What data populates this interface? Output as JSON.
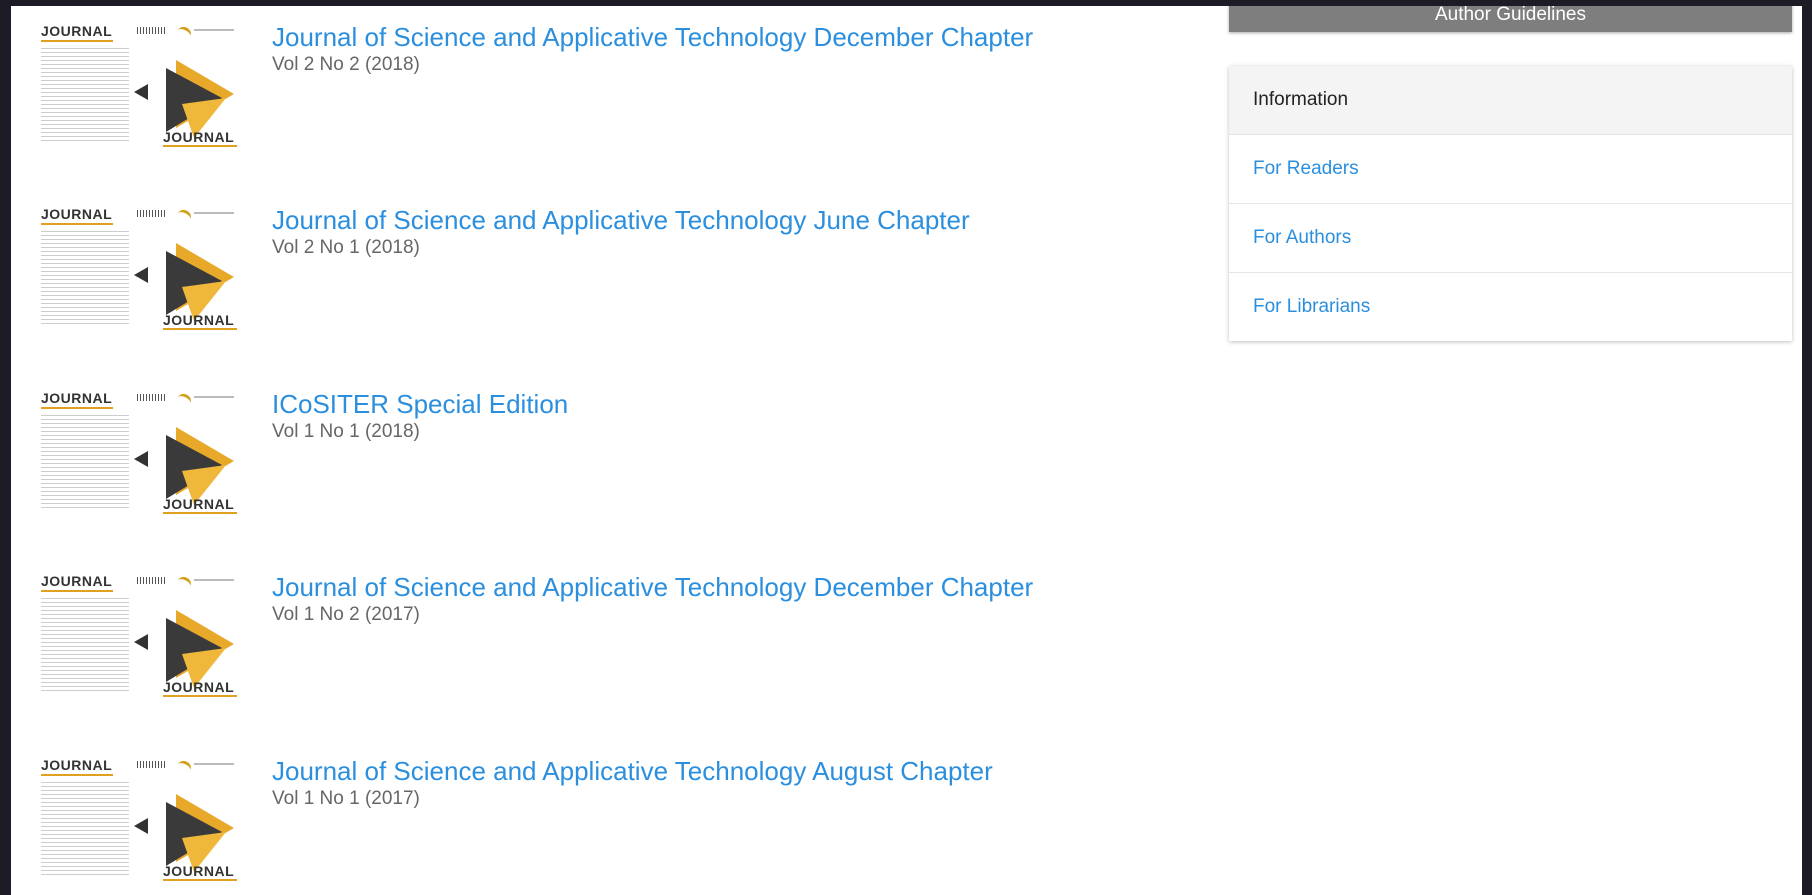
{
  "sidebar": {
    "guidelines_button": "Author Guidelines",
    "information": {
      "title": "Information",
      "links": [
        "For Readers",
        "For Authors",
        "For Librarians"
      ]
    }
  },
  "cover": {
    "journal_word": "JOURNAL"
  },
  "issues": [
    {
      "title": "Journal of Science and Applicative Technology December Chapter",
      "series": "Vol 2 No 2 (2018)"
    },
    {
      "title": "Journal of Science and Applicative Technology June Chapter",
      "series": "Vol 2 No 1 (2018)"
    },
    {
      "title": "ICoSITER Special Edition",
      "series": "Vol 1 No 1 (2018)"
    },
    {
      "title": "Journal of Science and Applicative Technology December Chapter",
      "series": "Vol 1 No 2 (2017)"
    },
    {
      "title": "Journal of Science and Applicative Technology August Chapter",
      "series": "Vol 1 No 1 (2017)"
    }
  ],
  "colors": {
    "link": "#2b8fde",
    "accent": "#e0a020",
    "button": "#7e7e7e"
  }
}
